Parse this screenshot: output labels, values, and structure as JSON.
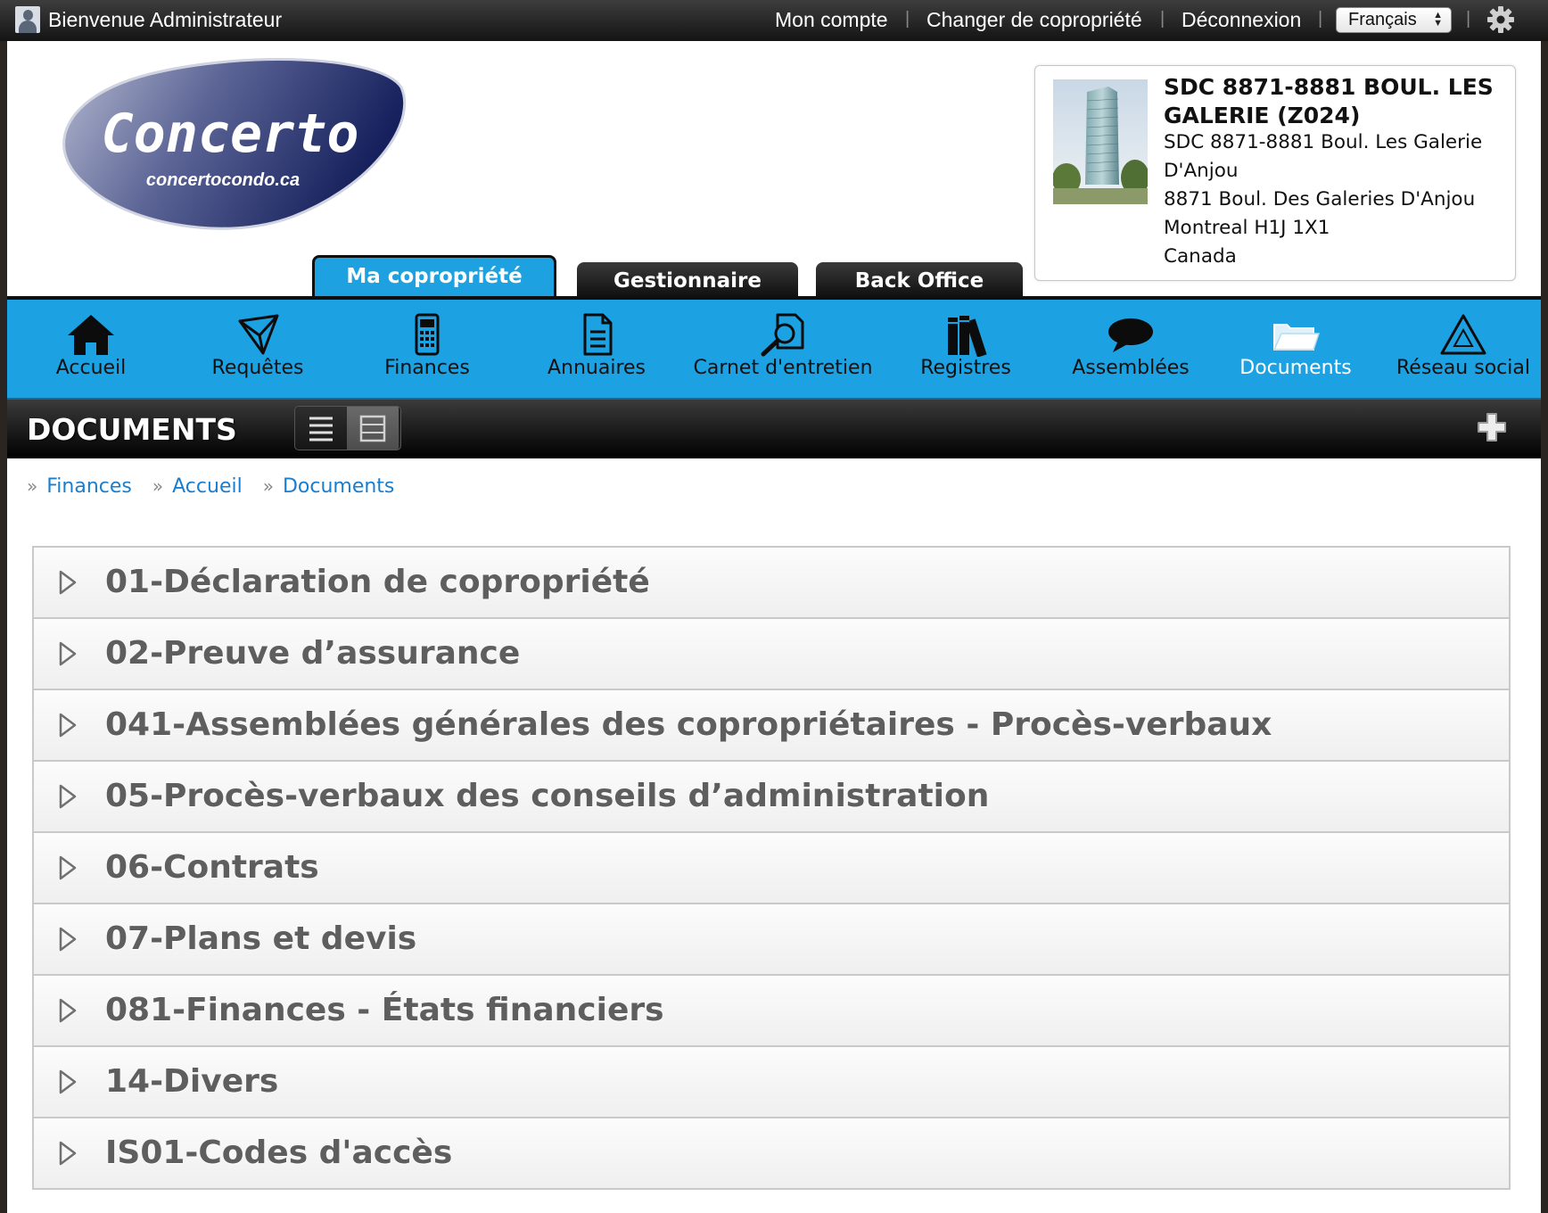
{
  "topbar": {
    "welcome": "Bienvenue Administrateur",
    "links": [
      "Mon compte",
      "Changer de copropriété",
      "Déconnexion"
    ],
    "language": "Français"
  },
  "logo": {
    "name": "Concerto",
    "url": "concertocondo.ca"
  },
  "property": {
    "name": "SDC 8871-8881 BOUL. LES GALERIE (Z024)",
    "lines": [
      "SDC 8871-8881 Boul. Les Galerie",
      "D'Anjou",
      "8871 Boul. Des Galeries D'Anjou",
      "Montreal H1J 1X1",
      "Canada"
    ]
  },
  "main_tabs": [
    {
      "label": "Ma copropriété",
      "active": true
    },
    {
      "label": "Gestionnaire",
      "active": false
    },
    {
      "label": "Back Office",
      "active": false
    }
  ],
  "nav": [
    {
      "label": "Accueil",
      "icon": "home-icon"
    },
    {
      "label": "Requêtes",
      "icon": "paper-plane-icon"
    },
    {
      "label": "Finances",
      "icon": "calculator-icon"
    },
    {
      "label": "Annuaires",
      "icon": "document-icon"
    },
    {
      "label": "Carnet d'entretien",
      "icon": "magnifier-document-icon"
    },
    {
      "label": "Registres",
      "icon": "books-icon"
    },
    {
      "label": "Assemblées",
      "icon": "speech-bubble-icon"
    },
    {
      "label": "Documents",
      "icon": "folder-icon",
      "active": true
    },
    {
      "label": "Réseau social",
      "icon": "network-triangle-icon"
    }
  ],
  "section": {
    "title": "DOCUMENTS"
  },
  "breadcrumb": [
    "Finances",
    "Accueil",
    "Documents"
  ],
  "folders": [
    "01-Déclaration de copropriété",
    "02-Preuve d’assurance",
    "041-Assemblées générales des copropriétaires - Procès-verbaux",
    "05-Procès-verbaux des conseils d’administration",
    "06-Contrats",
    "07-Plans et devis",
    "081-Finances - États financiers",
    "14-Divers",
    "IS01-Codes d'accès"
  ],
  "colors": {
    "nav_blue": "#1ca1e2",
    "active_tab": "#1ea1e0",
    "link": "#1a7ecf",
    "logo_navy": "#1c2a66"
  }
}
